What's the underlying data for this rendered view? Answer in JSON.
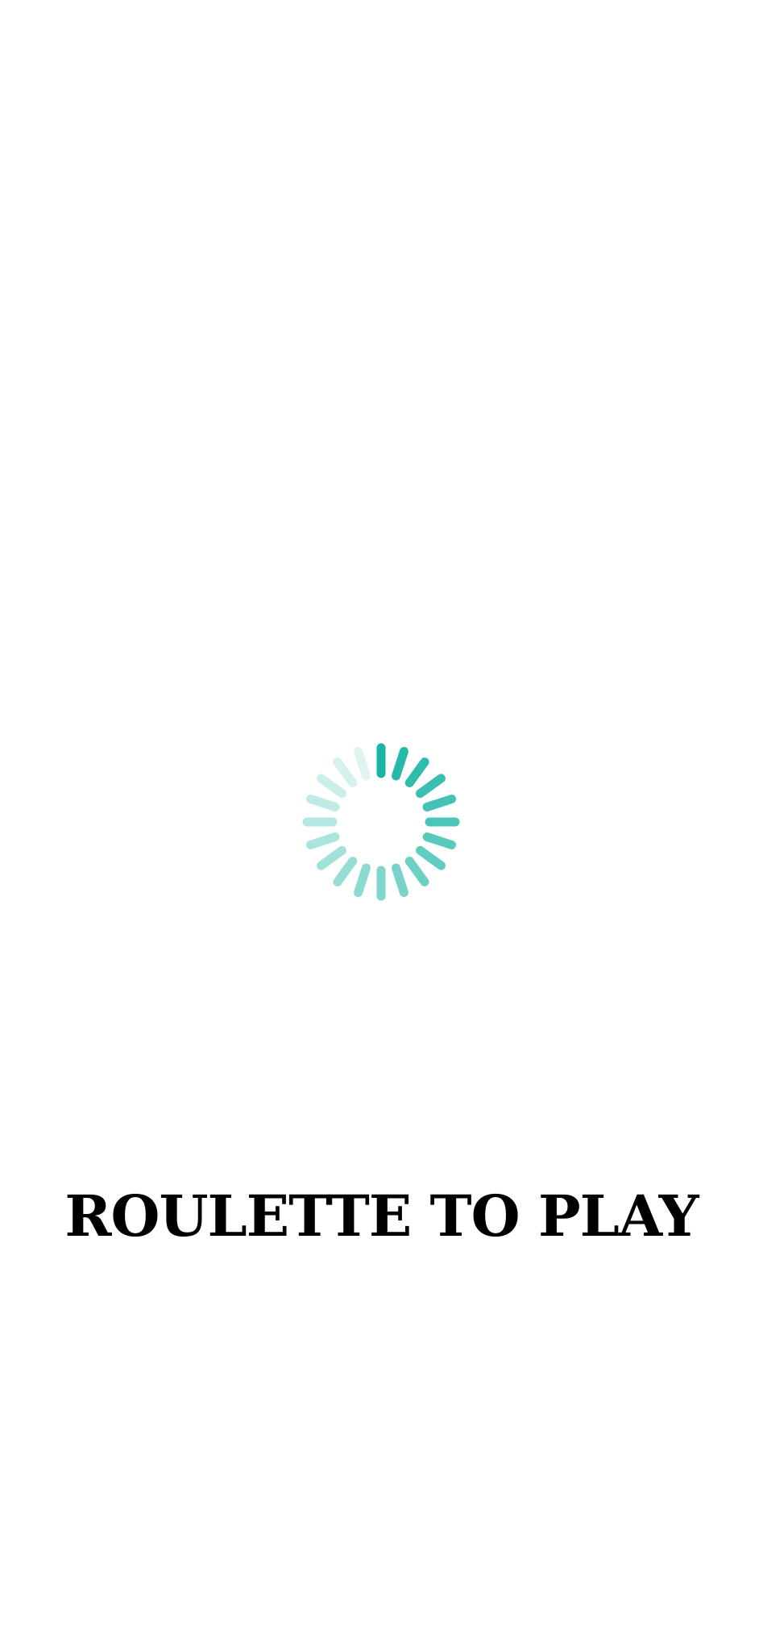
{
  "splash": {
    "title": "ROULETTE TO PLAY",
    "loader": {
      "icon": "loading-spinner-icon",
      "spoke_count": 20,
      "color": "#1ab5a5"
    },
    "background_color": "#ffffff",
    "title_color": "#000000"
  }
}
